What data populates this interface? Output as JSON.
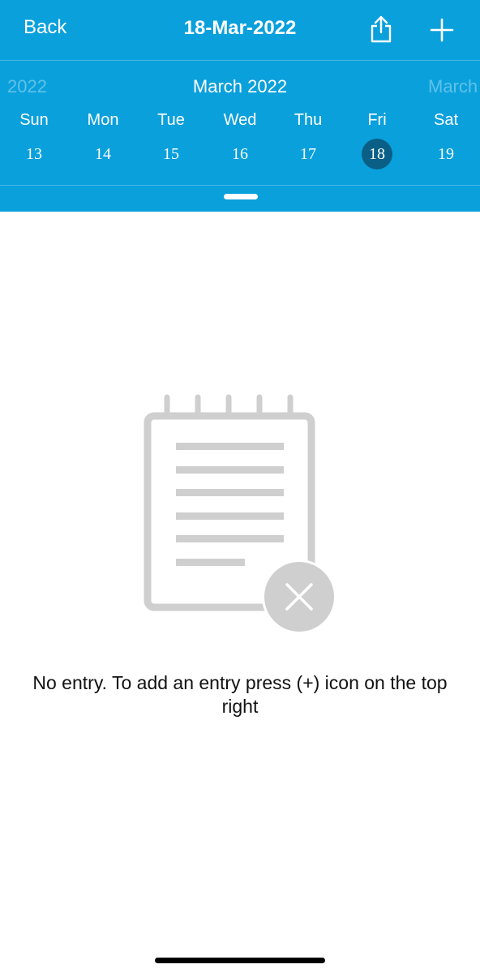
{
  "nav": {
    "back_label": "Back",
    "title": "18-Mar-2022",
    "share_icon": "share-icon",
    "add_icon": "plus-icon"
  },
  "calendar": {
    "prev_month_fragment": "2022",
    "current_month": "March 2022",
    "next_month_fragment": "March",
    "weekdays": [
      "Sun",
      "Mon",
      "Tue",
      "Wed",
      "Thu",
      "Fri",
      "Sat"
    ],
    "dates": [
      "13",
      "14",
      "15",
      "16",
      "17",
      "18",
      "19"
    ],
    "selected_date": "18"
  },
  "empty_state": {
    "icon": "empty-notepad-icon",
    "message": "No entry. To add an entry press (+) icon on the top right"
  },
  "colors": {
    "header_bg": "#0aa0dc",
    "selected_date_bg": "#0a5f86",
    "illustration_gray": "#cfcfcf"
  }
}
